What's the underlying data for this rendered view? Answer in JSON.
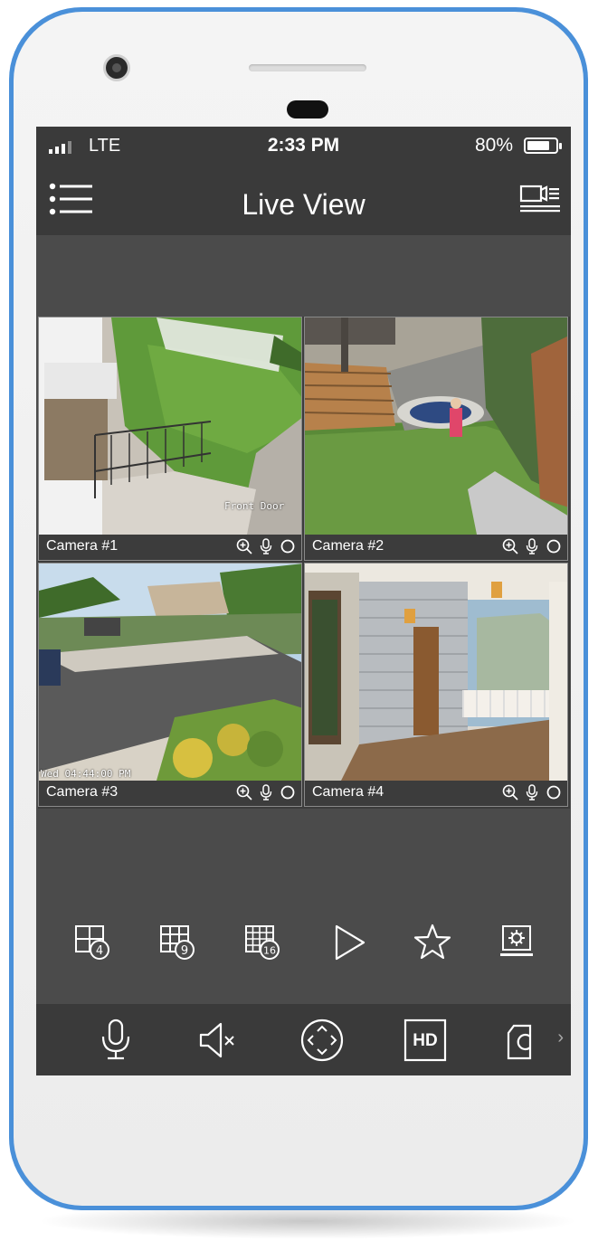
{
  "status_bar": {
    "network": "LTE",
    "time": "2:33 PM",
    "battery_percent": "80%",
    "battery_level": 0.8
  },
  "nav": {
    "title": "Live View",
    "menu_icon": "hamburger-menu-icon",
    "right_icon": "camera-list-icon"
  },
  "cameras": [
    {
      "label": "Camera #1",
      "overlay": "Front Door"
    },
    {
      "label": "Camera #2"
    },
    {
      "label": "Camera #3",
      "overlay": "Wed 04:44:00 PM"
    },
    {
      "label": "Camera #4"
    }
  ],
  "tile_controls": [
    "zoom-in-icon",
    "microphone-icon",
    "record-circle-icon"
  ],
  "layout_toolbar": {
    "grid4_badge": "4",
    "grid9_badge": "9",
    "grid16_badge": "16",
    "items": [
      "grid-4-icon",
      "grid-9-icon",
      "grid-16-icon",
      "play-icon",
      "star-icon",
      "settings-monitor-icon"
    ]
  },
  "action_toolbar": {
    "hd_label": "HD",
    "more_chevron": "›",
    "items": [
      "microphone-icon",
      "mute-speaker-icon",
      "ptz-direction-icon",
      "hd-icon",
      "snapshot-icon"
    ]
  },
  "colors": {
    "phone_frame": "#4a90d9",
    "screen_bg": "#4b4b4b",
    "bar_bg": "#3a3a3a"
  }
}
